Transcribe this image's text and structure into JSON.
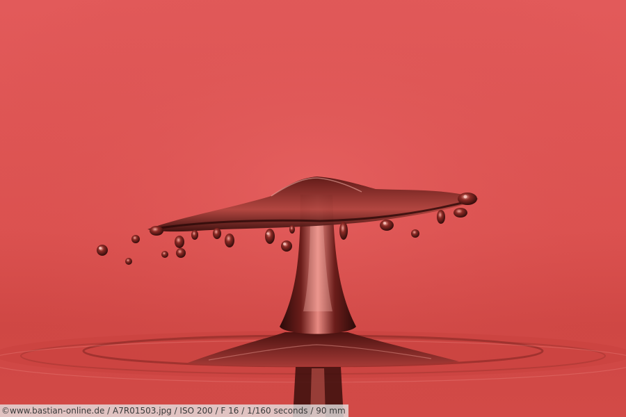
{
  "photo": {
    "subject": "water-drop-splash",
    "colors": {
      "background_top": "#e1585a",
      "background_mid": "#d44a48",
      "water_surface": "#c43f3c",
      "drop_dark": "#3a0f0d",
      "highlight": "#f7b0a6"
    }
  },
  "caption": {
    "text": "©www.bastian-online.de / A7R01503.jpg / ISO 200 / F 16 / 1/160 seconds  / 90 mm"
  }
}
